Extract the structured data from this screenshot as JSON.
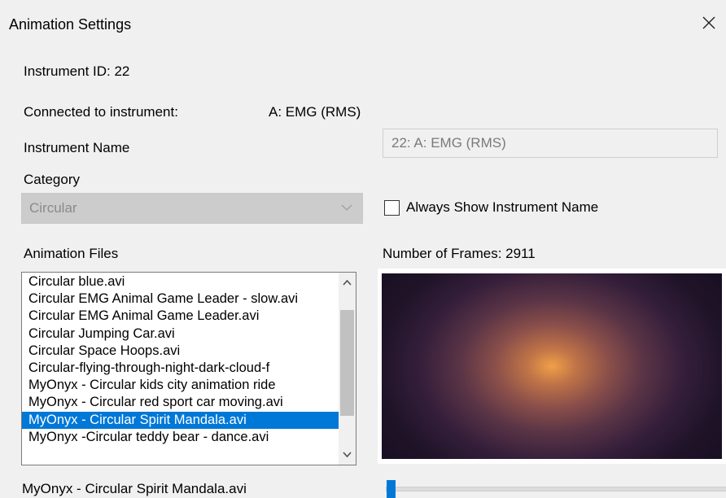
{
  "dialog": {
    "title": "Animation Settings"
  },
  "instrument": {
    "id_text": "Instrument ID: 22",
    "connected_label": "Connected to instrument:",
    "connected_value": "A: EMG (RMS)",
    "name_label": "Instrument Name",
    "name_value": "22: A: EMG (RMS)"
  },
  "category": {
    "label": "Category",
    "selected": "Circular"
  },
  "options": {
    "always_show_name_label": "Always Show Instrument Name",
    "always_show_name_checked": false
  },
  "animation_files": {
    "label": "Animation Files",
    "items": [
      "Circular blue.avi",
      "Circular EMG Animal Game Leader - slow.avi",
      "Circular EMG Animal Game Leader.avi",
      "Circular Jumping Car.avi",
      "Circular Space Hoops.avi",
      "Circular-flying-through-night-dark-cloud-f",
      "MyOnyx - Circular kids city animation ride",
      "MyOnyx - Circular red sport car moving.avi",
      "MyOnyx - Circular Spirit Mandala.avi",
      "MyOnyx -Circular teddy bear - dance.avi"
    ],
    "selected_index": 8,
    "selected_file": "MyOnyx - Circular Spirit Mandala.avi"
  },
  "preview": {
    "frames_text": "Number of Frames: 2911",
    "slider_position": 0
  },
  "colors": {
    "selection": "#0078d7",
    "background": "#f0f0f0"
  },
  "icons": {
    "close": "close-icon",
    "combo_arrow": "chevron-down-icon",
    "scroll_up": "chevron-up-icon",
    "scroll_down": "chevron-down-icon"
  }
}
